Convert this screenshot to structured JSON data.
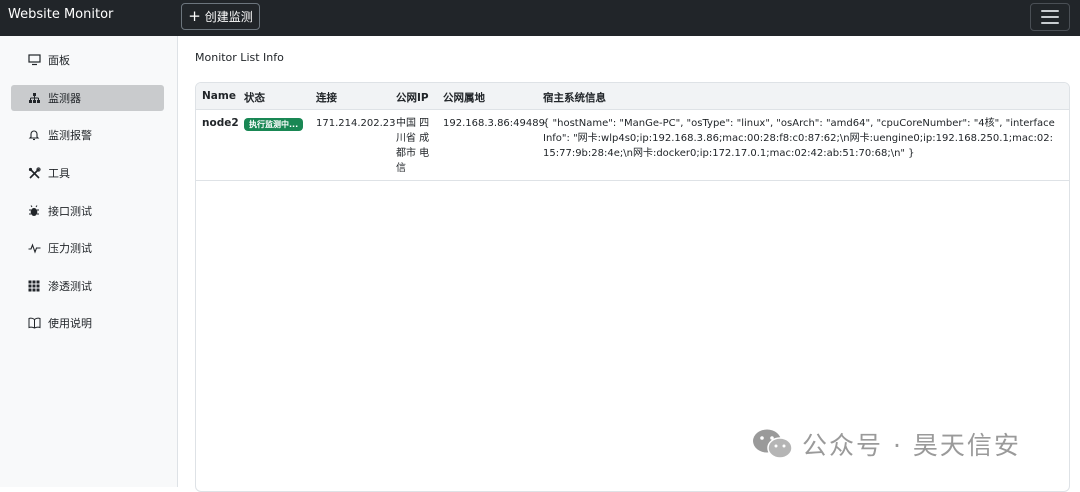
{
  "navbar": {
    "brand": "Website Monitor",
    "create_label": "创建监测"
  },
  "sidebar": {
    "items": [
      {
        "label": "面板",
        "icon": "monitor-icon"
      },
      {
        "label": "监测器",
        "icon": "sitemap-icon",
        "active": true
      },
      {
        "label": "监测报警",
        "icon": "bell-icon"
      },
      {
        "label": "工具",
        "icon": "tools-icon"
      },
      {
        "label": "接口测试",
        "icon": "bug-icon"
      },
      {
        "label": "压力测试",
        "icon": "pulse-icon"
      },
      {
        "label": "渗透测试",
        "icon": "grid-icon"
      },
      {
        "label": "使用说明",
        "icon": "book-icon"
      }
    ]
  },
  "main": {
    "title": "Monitor List Info",
    "table": {
      "headers": [
        "Name",
        "状态",
        "连接",
        "公网IP",
        "公网属地",
        "宿主系统信息"
      ],
      "rows": [
        {
          "name": "node2",
          "status": "执行监测中...",
          "connection": "171.214.202.23",
          "public_ip": "中国 四川省 成都市 电信",
          "public_location": "192.168.3.86:49489",
          "host_info": "{ \"hostName\": \"ManGe-PC\", \"osType\": \"linux\", \"osArch\": \"amd64\", \"cpuCoreNumber\": \"4核\", \"interfaceInfo\": \"网卡:wlp4s0;ip:192.168.3.86;mac:00:28:f8:c0:87:62;\\n网卡:uengine0;ip:192.168.250.1;mac:02:15:77:9b:28:4e;\\n网卡:docker0;ip:172.17.0.1;mac:02:42:ab:51:70:68;\\n\" }"
        }
      ]
    }
  },
  "watermark": {
    "text": "公众号 · 昊天信安"
  },
  "colors": {
    "navbar_bg": "#212529",
    "badge_bg": "#198754",
    "active_item_bg": "#c9cbcd"
  }
}
